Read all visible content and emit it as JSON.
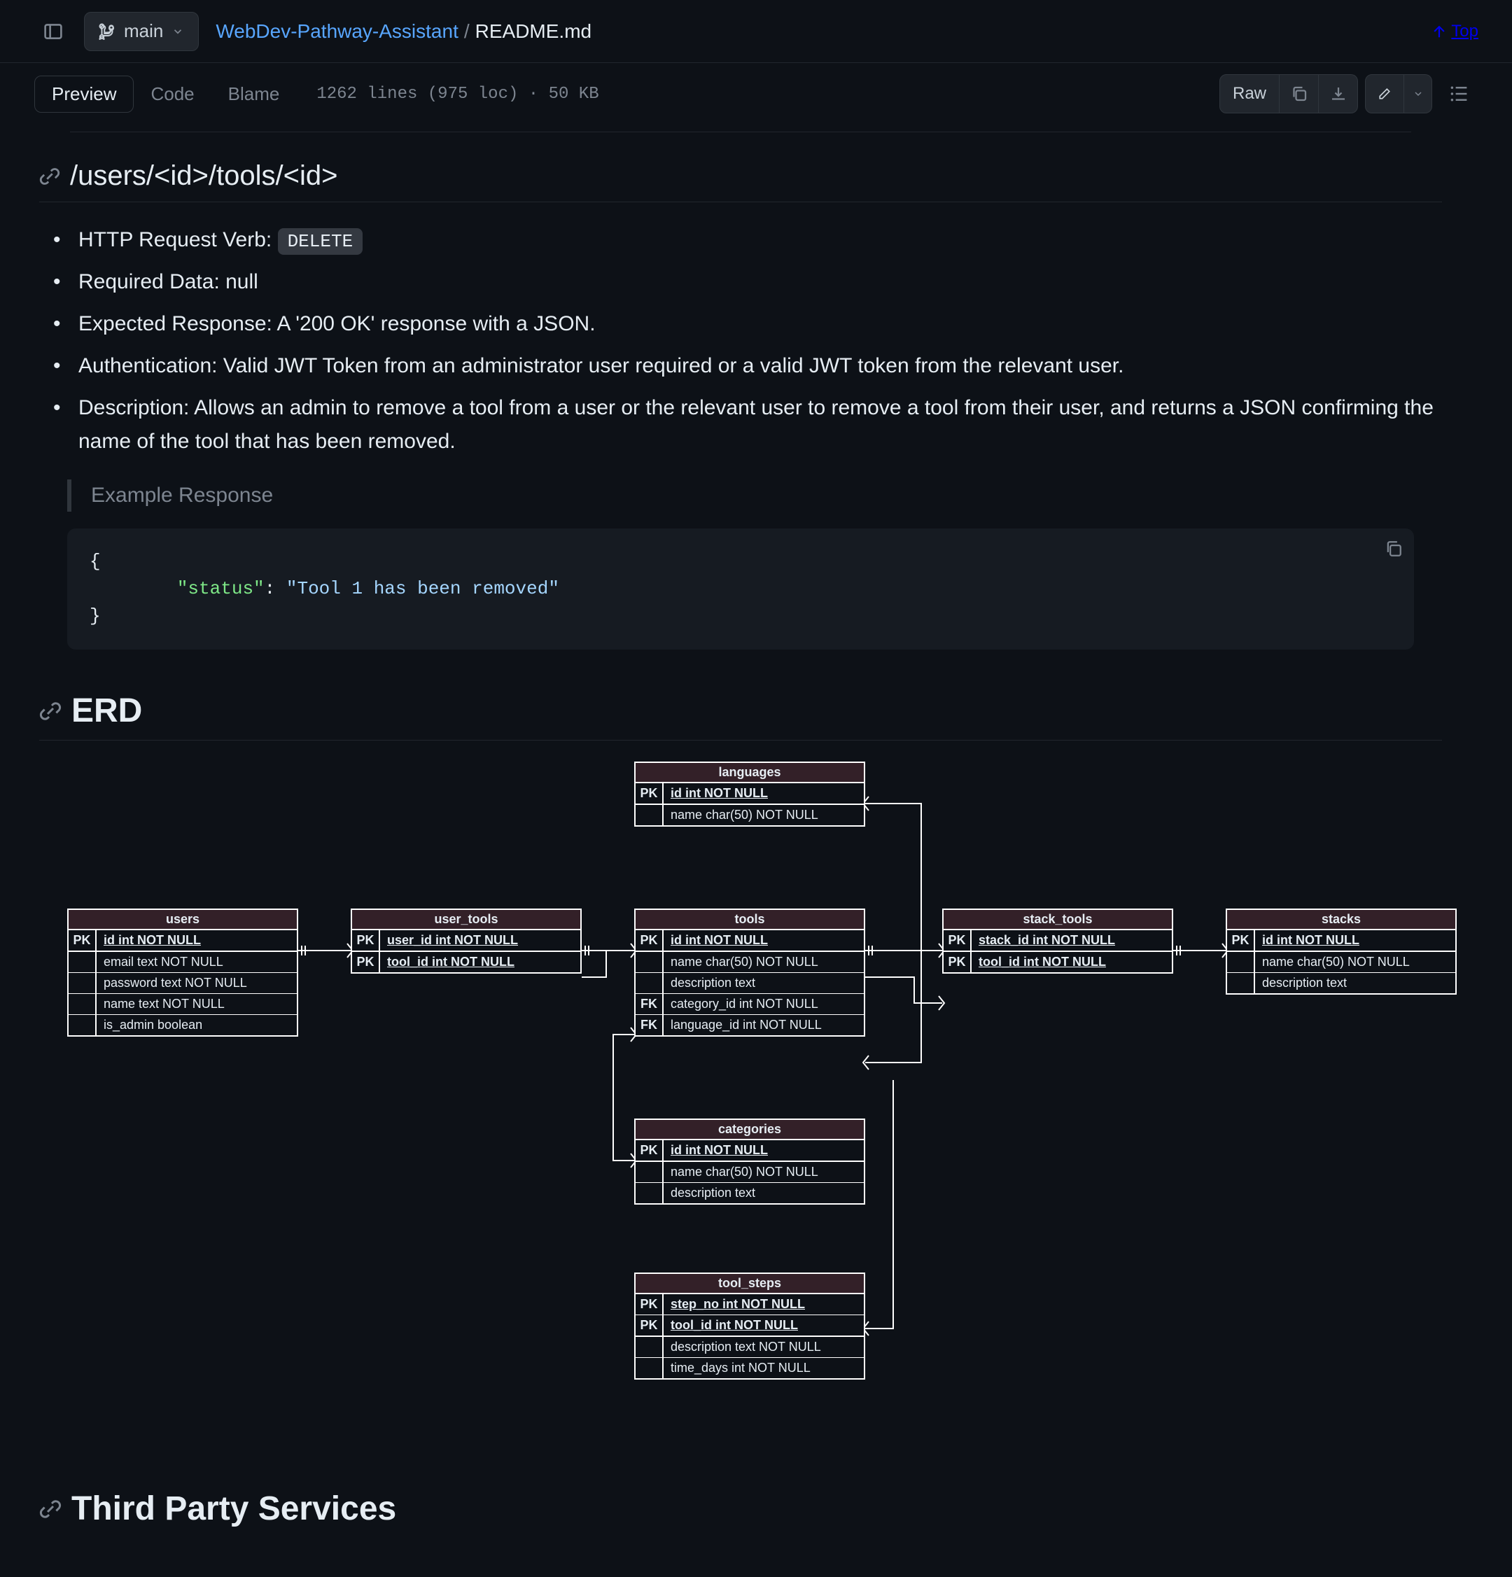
{
  "topbar": {
    "branch": "main",
    "repo": "WebDev-Pathway-Assistant",
    "sep": "/",
    "file": "README.md",
    "top_label": "Top"
  },
  "tabs": {
    "preview": "Preview",
    "code": "Code",
    "blame": "Blame"
  },
  "meta": "1262 lines (975 loc) · 50 KB",
  "raw_label": "Raw",
  "endpoint": {
    "path": "/users/<id>/tools/<id>",
    "items": [
      {
        "label": "HTTP Request Verb: ",
        "badge": "DELETE"
      },
      {
        "label": "Required Data: null"
      },
      {
        "label": "Expected Response: A '200 OK' response with a JSON."
      },
      {
        "label": "Authentication: Valid JWT Token from an administrator user required or a valid JWT token from the relevant user."
      },
      {
        "label": "Description: Allows an admin to remove a tool from a user or the relevant user to remove a tool from their user, and returns a JSON confirming the name of the tool that has been removed."
      }
    ],
    "quote": "Example Response",
    "code": {
      "open": "{",
      "key": "\"status\"",
      "colon": ": ",
      "val": "\"Tool 1 has been removed\"",
      "close": "}"
    }
  },
  "erd": {
    "title": "ERD",
    "tables": {
      "languages": {
        "name": "languages",
        "rows": [
          [
            "PK",
            "id int NOT NULL",
            true,
            true
          ],
          [
            "",
            "name char(50) NOT NULL",
            false,
            false
          ]
        ]
      },
      "users": {
        "name": "users",
        "rows": [
          [
            "PK",
            "id int NOT NULL",
            true,
            true
          ],
          [
            "",
            "email text NOT NULL",
            false,
            false
          ],
          [
            "",
            "password text NOT NULL",
            false,
            false
          ],
          [
            "",
            "name text NOT NULL",
            false,
            false
          ],
          [
            "",
            "is_admin boolean",
            false,
            false
          ]
        ]
      },
      "user_tools": {
        "name": "user_tools",
        "rows": [
          [
            "PK",
            "user_id int NOT NULL",
            true,
            true
          ],
          [
            "PK",
            "tool_id int NOT NULL",
            true,
            false
          ]
        ]
      },
      "tools": {
        "name": "tools",
        "rows": [
          [
            "PK",
            "id int NOT NULL",
            true,
            true
          ],
          [
            "",
            "name char(50) NOT NULL",
            false,
            false
          ],
          [
            "",
            "description text",
            false,
            false
          ],
          [
            "FK",
            "category_id int NOT NULL",
            false,
            false
          ],
          [
            "FK",
            "language_id int NOT NULL",
            false,
            false
          ]
        ]
      },
      "stack_tools": {
        "name": "stack_tools",
        "rows": [
          [
            "PK",
            "stack_id int NOT NULL",
            true,
            true
          ],
          [
            "PK",
            "tool_id int NOT NULL",
            true,
            false
          ]
        ]
      },
      "stacks": {
        "name": "stacks",
        "rows": [
          [
            "PK",
            "id int NOT NULL",
            true,
            true
          ],
          [
            "",
            "name char(50) NOT NULL",
            false,
            false
          ],
          [
            "",
            "description text",
            false,
            false
          ]
        ]
      },
      "categories": {
        "name": "categories",
        "rows": [
          [
            "PK",
            "id int NOT NULL",
            true,
            true
          ],
          [
            "",
            "name char(50) NOT NULL",
            false,
            false
          ],
          [
            "",
            "description text",
            false,
            false
          ]
        ]
      },
      "tool_steps": {
        "name": "tool_steps",
        "rows": [
          [
            "PK",
            "step_no int NOT NULL",
            true,
            false
          ],
          [
            "PK",
            "tool_id int NOT NULL",
            true,
            true
          ],
          [
            "",
            "description text NOT NULL",
            false,
            false
          ],
          [
            "",
            "time_days int NOT NULL",
            false,
            false
          ]
        ]
      }
    }
  },
  "third": "Third Party Services"
}
